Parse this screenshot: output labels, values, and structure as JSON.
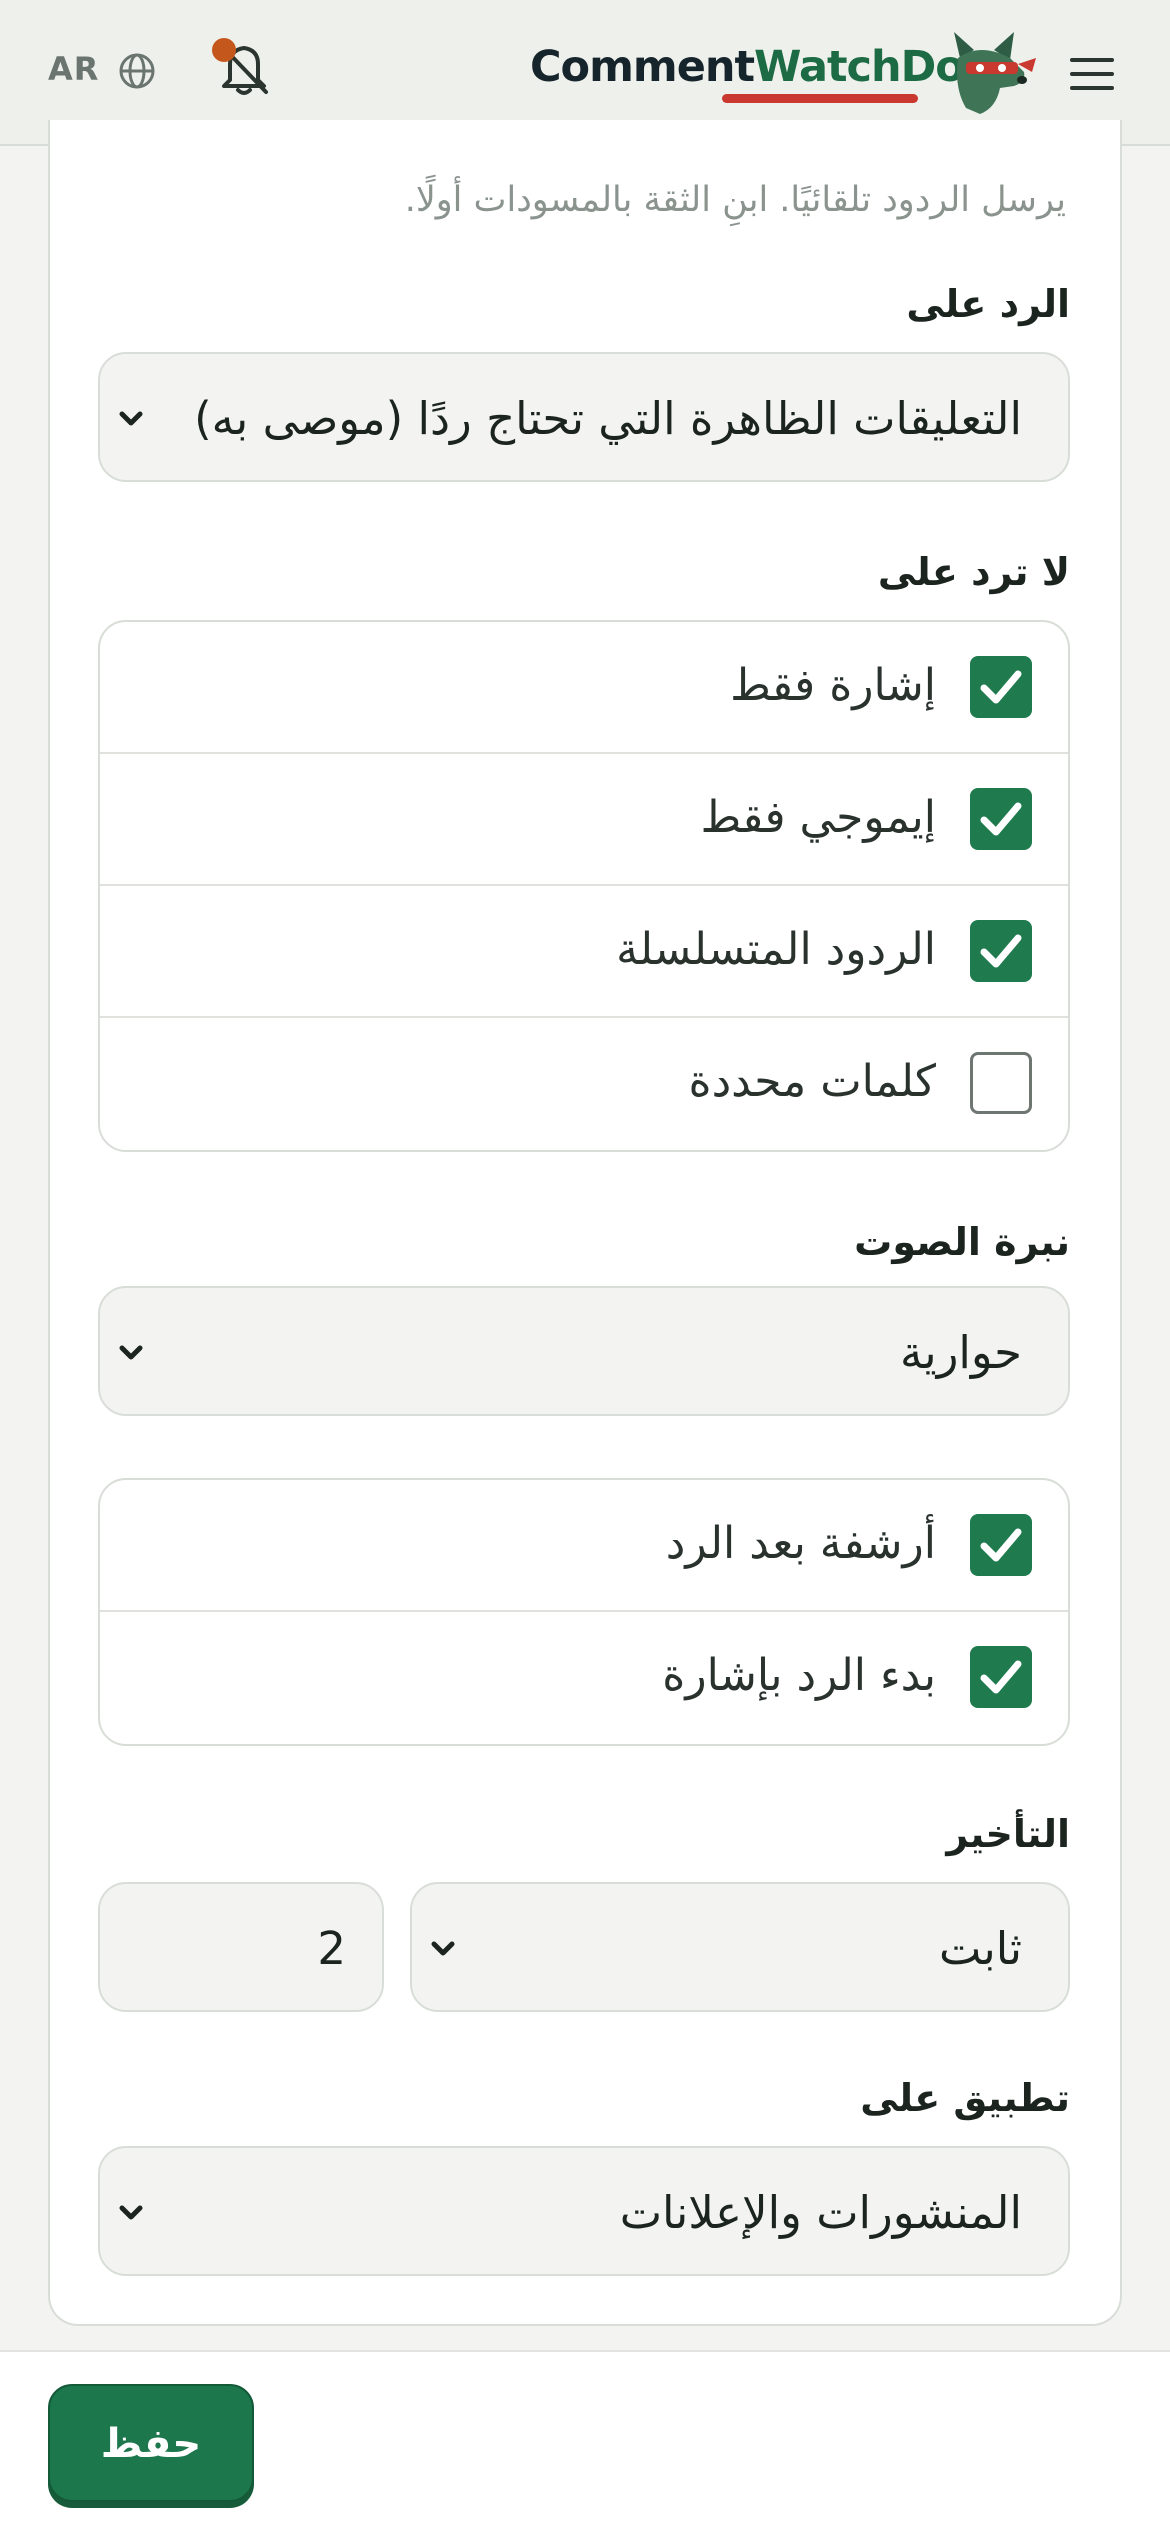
{
  "header": {
    "language": "AR",
    "brand_part1": "Comment",
    "brand_part2": "WatchDog",
    "icons": [
      "globe-icon",
      "bell-off-icon",
      "dog-logo",
      "hamburger-menu-icon"
    ],
    "notification_dot_color": "#c4581c",
    "brand_color": "#1d6b44"
  },
  "form": {
    "hint": "يرسل الردود تلقائيًا. ابنِ الثقة بالمسودات أولًا.",
    "reply_to": {
      "label": "الرد على",
      "value": "التعليقات الظاهرة التي تحتاج ردًا (موصى به)"
    },
    "dont_reply": {
      "label": "لا ترد على",
      "options": [
        {
          "label": "إشارة فقط",
          "checked": true
        },
        {
          "label": "إيموجي فقط",
          "checked": true
        },
        {
          "label": "الردود المتسلسلة",
          "checked": true
        },
        {
          "label": "كلمات محددة",
          "checked": false
        }
      ]
    },
    "tone": {
      "label": "نبرة الصوت",
      "value": "حوارية"
    },
    "extras": [
      {
        "label": "أرشفة بعد الرد",
        "checked": true
      },
      {
        "label": "بدء الرد بإشارة",
        "checked": true
      }
    ],
    "delay": {
      "label": "التأخير",
      "mode": "ثابت",
      "amount": "2"
    },
    "apply_to": {
      "label": "تطبيق على",
      "value": "المنشورات والإعلانات"
    }
  },
  "footer": {
    "save_label": "حفظ",
    "accent": "#1f7a4e"
  }
}
